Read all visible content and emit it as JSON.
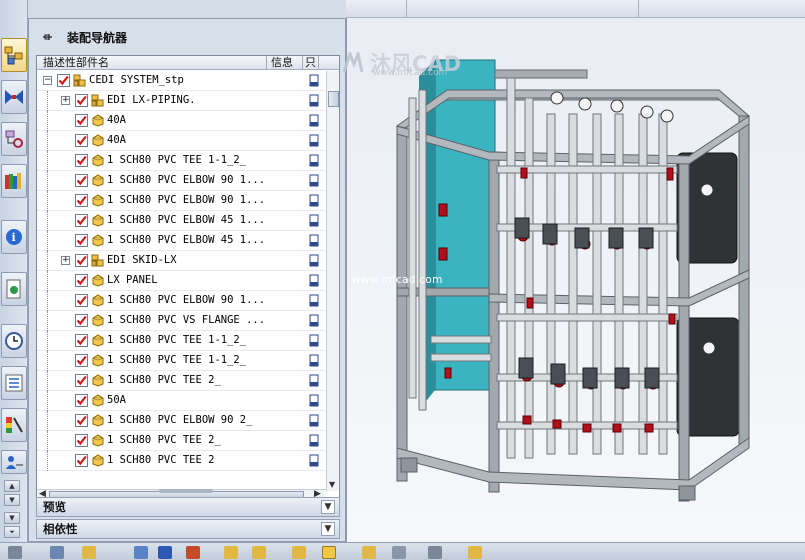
{
  "navigator": {
    "title": "装配导航器",
    "columns": {
      "name": "描述性部件名",
      "info": "信息",
      "only": "只"
    },
    "rows": [
      {
        "label": "CEDI SYSTEM_stp",
        "level": 0,
        "expander": "−",
        "icon": "assembly-icon"
      },
      {
        "label": "EDI LX-PIPING.",
        "level": 1,
        "expander": "+",
        "icon": "assembly-icon"
      },
      {
        "label": "40A",
        "level": 1,
        "expander": "",
        "icon": "part-icon"
      },
      {
        "label": "40A",
        "level": 1,
        "expander": "",
        "icon": "part-icon"
      },
      {
        "label": "1 SCH80 PVC TEE 1-1_2_",
        "level": 1,
        "expander": "",
        "icon": "part-icon"
      },
      {
        "label": "1 SCH80 PVC ELBOW 90 1...",
        "level": 1,
        "expander": "",
        "icon": "part-icon"
      },
      {
        "label": "1 SCH80 PVC ELBOW 90 1...",
        "level": 1,
        "expander": "",
        "icon": "part-icon"
      },
      {
        "label": "1 SCH80 PVC ELBOW 45 1...",
        "level": 1,
        "expander": "",
        "icon": "part-icon"
      },
      {
        "label": "1 SCH80 PVC ELBOW 45 1...",
        "level": 1,
        "expander": "",
        "icon": "part-icon"
      },
      {
        "label": "EDI SKID-LX",
        "level": 1,
        "expander": "+",
        "icon": "assembly-icon"
      },
      {
        "label": "LX PANEL",
        "level": 1,
        "expander": "",
        "icon": "part-icon"
      },
      {
        "label": "1 SCH80 PVC ELBOW 90 1...",
        "level": 1,
        "expander": "",
        "icon": "part-icon"
      },
      {
        "label": "1 SCH80 PVC VS FLANGE ...",
        "level": 1,
        "expander": "",
        "icon": "part-icon"
      },
      {
        "label": "1 SCH80 PVC TEE 1-1_2_",
        "level": 1,
        "expander": "",
        "icon": "part-icon"
      },
      {
        "label": "1 SCH80 PVC TEE 1-1_2_",
        "level": 1,
        "expander": "",
        "icon": "part-icon"
      },
      {
        "label": "1 SCH80 PVC TEE 2_",
        "level": 1,
        "expander": "",
        "icon": "part-icon"
      },
      {
        "label": "50A",
        "level": 1,
        "expander": "",
        "icon": "part-icon"
      },
      {
        "label": "1 SCH80 PVC ELBOW 90 2_",
        "level": 1,
        "expander": "",
        "icon": "part-icon"
      },
      {
        "label": "1 SCH80 PVC TEE 2_",
        "level": 1,
        "expander": "",
        "icon": "part-icon"
      },
      {
        "label": "1 SCH80 PVC TEE 2",
        "level": 1,
        "expander": "",
        "icon": "part-icon"
      }
    ],
    "sections": {
      "preview": "预览",
      "dependency": "相依性"
    }
  },
  "viewport": {
    "logo": "沐风CAD",
    "logo_sub": "www.mfcad.com",
    "watermark": "www.mfcad.com"
  },
  "colors": {
    "check_red": "#d01818",
    "frame_gray": "#9aa1a8",
    "panel_cyan": "#3fb9c4",
    "valve_red": "#b0101a"
  }
}
